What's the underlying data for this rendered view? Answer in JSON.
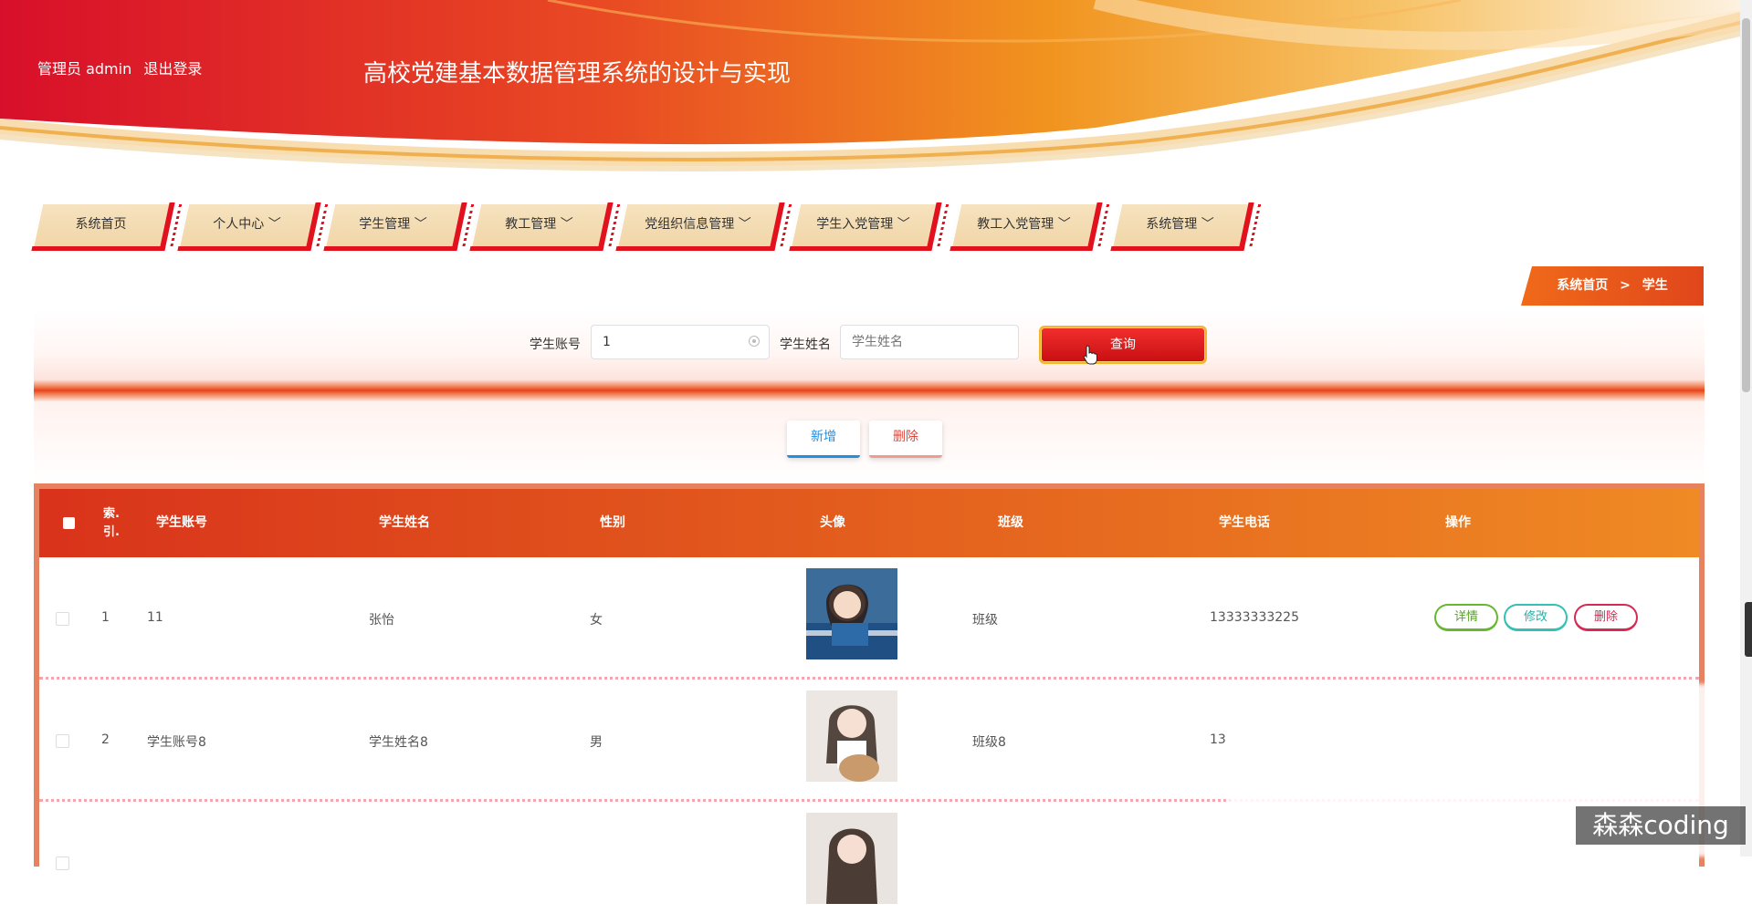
{
  "header": {
    "role_label": "管理员 admin",
    "logout_label": "退出登录",
    "site_title": "高校党建基本数据管理系统的设计与实现"
  },
  "nav": {
    "items": [
      {
        "label": "系统首页"
      },
      {
        "label": "个人中心 ﹀"
      },
      {
        "label": "学生管理 ﹀"
      },
      {
        "label": "教工管理 ﹀"
      },
      {
        "label": "党组织信息管理 ﹀"
      },
      {
        "label": "学生入党管理 ﹀"
      },
      {
        "label": "教工入党管理 ﹀"
      },
      {
        "label": "系统管理 ﹀"
      }
    ]
  },
  "breadcrumb": {
    "home": "系统首页",
    "separator": ">",
    "current": "学生"
  },
  "search": {
    "account_label": "学生账号",
    "account_value": "1",
    "name_label": "学生姓名",
    "name_placeholder": "学生姓名",
    "query_label": "查询"
  },
  "actions": {
    "add_label": "新增",
    "delete_label": "删除"
  },
  "table": {
    "index_header_line1": "索.",
    "index_header_line2": "引.",
    "headers": {
      "account": "学生账号",
      "name": "学生姓名",
      "gender": "性别",
      "avatar": "头像",
      "class": "班级",
      "phone": "学生电话",
      "ops": "操作"
    },
    "rows": [
      {
        "index": "1",
        "account": "11",
        "name": "张怡",
        "gender": "女",
        "class": "班级",
        "phone": "13333333225"
      },
      {
        "index": "2",
        "account": "学生账号8",
        "name": "学生姓名8",
        "gender": "男",
        "class": "班级8",
        "phone": "13"
      }
    ],
    "op_labels": {
      "detail": "详情",
      "edit": "修改",
      "delete": "删除"
    }
  },
  "watermark": "森森coding",
  "colors": {
    "brand_red": "#e1121d",
    "header_orange": "#ef8a24",
    "accent_gold": "#f1d6a8"
  }
}
